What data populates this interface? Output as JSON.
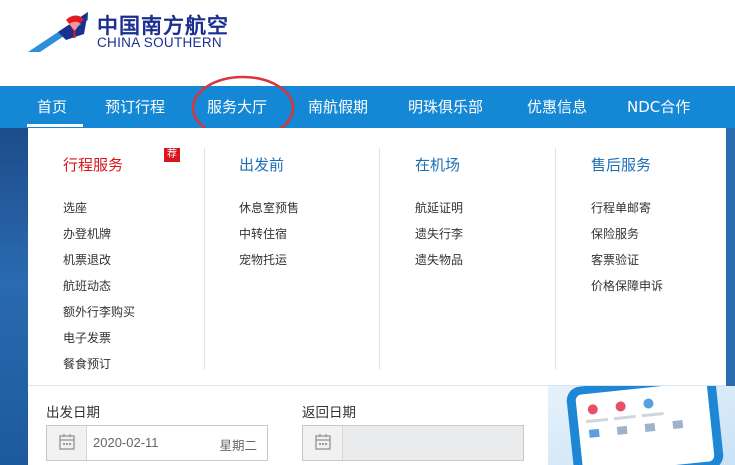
{
  "brand": {
    "name_cn": "中国南方航空",
    "name_en": "CHINA SOUTHERN",
    "color_primary": "#1b2f8f",
    "color_nav": "#1487d5"
  },
  "nav": {
    "items": [
      {
        "label": "首页",
        "active": true
      },
      {
        "label": "预订行程"
      },
      {
        "label": "服务大厅",
        "highlighted": true
      },
      {
        "label": "南航假期"
      },
      {
        "label": "明珠俱乐部"
      },
      {
        "label": "优惠信息"
      },
      {
        "label": "NDC合作"
      }
    ],
    "annotation_color": "#d9353a"
  },
  "menu": {
    "columns": [
      {
        "title": "行程服务",
        "badge": "荐",
        "links": [
          "选座",
          "办登机牌",
          "机票退改",
          "航班动态",
          "额外行李购买",
          "电子发票",
          "餐食预订"
        ]
      },
      {
        "title": "出发前",
        "links": [
          "休息室预售",
          "中转住宿",
          "宠物托运"
        ]
      },
      {
        "title": "在机场",
        "links": [
          "航延证明",
          "遗失行李",
          "遗失物品"
        ]
      },
      {
        "title": "售后服务",
        "links": [
          "行程单邮寄",
          "保险服务",
          "客票验证",
          "价格保障申诉"
        ]
      }
    ]
  },
  "booking": {
    "depart_label": "出发日期",
    "depart_value": "2020-02-11",
    "depart_weekday": "星期二",
    "return_label": "返回日期",
    "return_value": ""
  },
  "icons": {
    "logo": "kapok-flower-logo-icon",
    "calendar": "calendar-icon"
  }
}
